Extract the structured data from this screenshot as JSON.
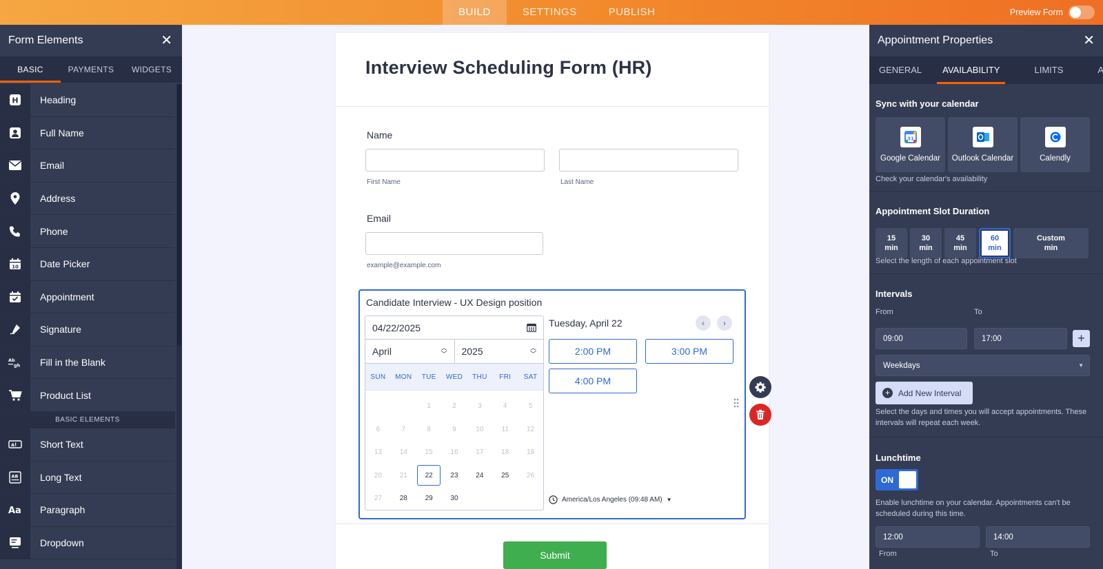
{
  "topbar": {
    "tabs": [
      "BUILD",
      "SETTINGS",
      "PUBLISH"
    ],
    "active": "BUILD",
    "preview_label": "Preview Form"
  },
  "left_panel": {
    "title": "Form Elements",
    "tabs": [
      "BASIC",
      "PAYMENTS",
      "WIDGETS"
    ],
    "items_top": [
      "Heading",
      "Full Name",
      "Email",
      "Address",
      "Phone",
      "Date Picker",
      "Appointment",
      "Signature",
      "Fill in the Blank",
      "Product List"
    ],
    "section_label": "BASIC ELEMENTS",
    "items_bottom": [
      "Short Text",
      "Long Text",
      "Paragraph",
      "Dropdown"
    ]
  },
  "form": {
    "title": "Interview Scheduling Form (HR)",
    "name_label": "Name",
    "first_name_sub": "First Name",
    "last_name_sub": "Last Name",
    "email_label": "Email",
    "email_sub": "example@example.com",
    "appointment": {
      "label": "Candidate Interview - UX Design position",
      "date_value": "04/22/2025",
      "month": "April",
      "year": "2025",
      "weekdays": [
        "SUN",
        "MON",
        "TUE",
        "WED",
        "THU",
        "FRI",
        "SAT"
      ],
      "days": [
        "",
        "",
        "1",
        "2",
        "3",
        "4",
        "5",
        "6",
        "7",
        "8",
        "9",
        "10",
        "11",
        "12",
        "13",
        "14",
        "15",
        "16",
        "17",
        "18",
        "19",
        "20",
        "21",
        "22",
        "23",
        "24",
        "25",
        "26",
        "27",
        "28",
        "29",
        "30"
      ],
      "available_days": [
        "23",
        "24",
        "25",
        "28",
        "29",
        "30"
      ],
      "selected_day": "22",
      "selected_date_text": "Tuesday, April 22",
      "time_slots": [
        "2:00 PM",
        "3:00 PM",
        "4:00 PM"
      ],
      "timezone": "America/Los Angeles (09:48 AM)"
    },
    "submit_label": "Submit"
  },
  "right_panel": {
    "title": "Appointment Properties",
    "tabs": [
      "GENERAL",
      "AVAILABILITY",
      "LIMITS",
      "ADVANCED"
    ],
    "active_tab": "AVAILABILITY",
    "sync": {
      "heading": "Sync with your calendar",
      "options": [
        "Google Calendar",
        "Outlook Calendar",
        "Calendly"
      ],
      "hint": "Check your calendar's availability"
    },
    "duration": {
      "heading": "Appointment Slot Duration",
      "options": [
        {
          "value": "15",
          "unit": "min"
        },
        {
          "value": "30",
          "unit": "min"
        },
        {
          "value": "45",
          "unit": "min"
        },
        {
          "value": "60",
          "unit": "min"
        },
        {
          "value": "Custom",
          "unit": "min"
        }
      ],
      "selected": "60",
      "hint": "Select the length of each appointment slot"
    },
    "intervals": {
      "heading": "Intervals",
      "from_label": "From",
      "to_label": "To",
      "from_value": "09:00",
      "to_value": "17:00",
      "days_value": "Weekdays",
      "add_label": "Add New Interval",
      "hint": "Select the days and times you will accept appointments. These intervals will repeat each week."
    },
    "lunchtime": {
      "heading": "Lunchtime",
      "toggle_label": "ON",
      "hint": "Enable lunchtime on your calendar. Appointments can't be scheduled during this time.",
      "from_value": "12:00",
      "to_value": "14:00",
      "from_label": "From",
      "to_label": "To"
    }
  },
  "colors": {
    "accent": "#2e69d6",
    "topbar_orange": "#f28a2c",
    "panel_dark": "#343c53",
    "submit_green": "#3fae4f",
    "delete_red": "#dc2626"
  }
}
